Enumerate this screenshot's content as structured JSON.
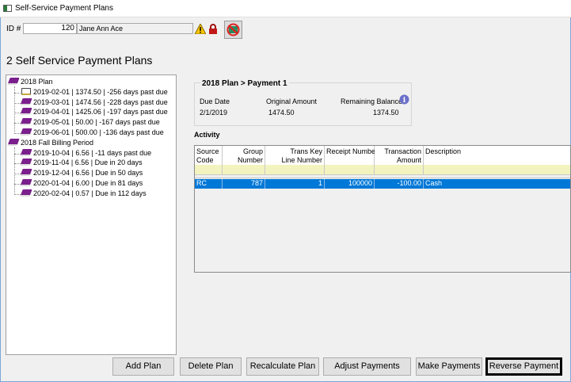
{
  "window": {
    "title": "Self-Service Payment Plans"
  },
  "header": {
    "id_label": "ID #",
    "id_value": "120",
    "name_value": "Jane Ann Ace",
    "icons": [
      "warning-icon",
      "lock-icon",
      "no-email-icon"
    ]
  },
  "heading": "2 Self Service Payment Plans",
  "tree": [
    {
      "label": "2018 Plan",
      "children": [
        "2019-02-01 | 1374.50 | -256 days past due",
        "2019-03-01 | 1474.56 | -228 days past due",
        "2019-04-01 | 1425.06 | -197 days past due",
        "2019-05-01 | 50.00 | -167 days past due",
        "2019-06-01 | 500.00 | -136 days past due"
      ]
    },
    {
      "label": "2018 Fall Billing Period",
      "children": [
        "2019-10-04 | 6.56 | -11 days past due",
        "2019-11-04 | 6.56 | Due in 20 days",
        "2019-12-04 | 6.56 | Due in 50 days",
        "2020-01-04 | 6.00 | Due in 81 days",
        "2020-02-04 | 0.57 | Due in 112 days"
      ]
    }
  ],
  "details": {
    "title": "2018 Plan > Payment 1",
    "due_date_label": "Due Date",
    "due_date": "2/1/2019",
    "original_label": "Original Amount",
    "original": "1474.50",
    "remaining_label": "Remaining Balance",
    "remaining": "1374.50"
  },
  "activity": {
    "label": "Activity",
    "columns": [
      "Source\nCode",
      "Group\nNumber",
      "Trans Key\nLine Number",
      "Receipt Number",
      "Transaction\nAmount",
      "Description"
    ],
    "rows": [
      [
        "RC",
        "787",
        "1",
        "100000",
        "-100.00",
        "Cash"
      ]
    ]
  },
  "buttons": [
    "Add Plan",
    "Delete Plan",
    "Recalculate Plan",
    "Adjust Payments",
    "Make Payments",
    "Reverse Payment"
  ],
  "colors": {
    "selection": "#0078d7",
    "filter_row": "#f3f3c0",
    "plan_icon": "#7a1f8c"
  }
}
